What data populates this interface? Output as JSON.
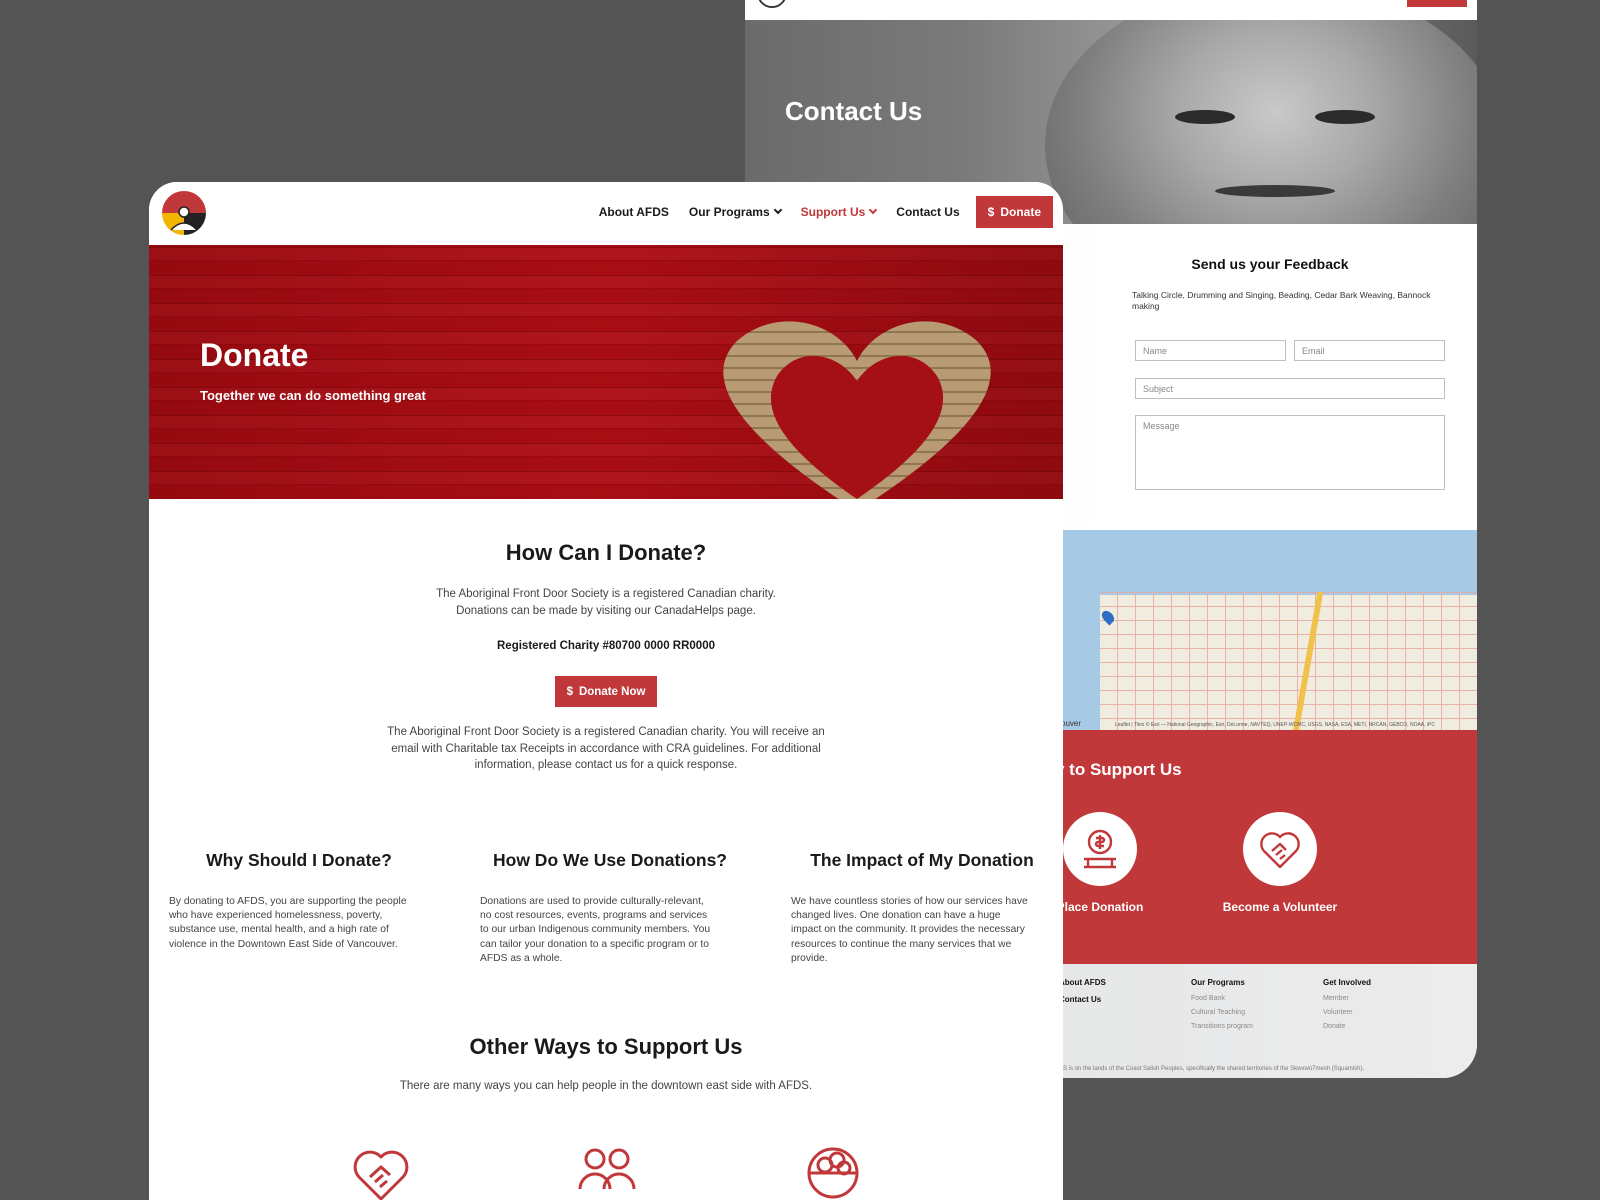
{
  "contact_page": {
    "hero_title": "Contact Us",
    "feedback": {
      "title": "Send us your Feedback",
      "intro": "Talking Circle, Drumming and Singing, Beading, Cedar Bark Weaving, Bannock making",
      "name_placeholder": "Name",
      "email_placeholder": "Email",
      "subject_placeholder": "Subject",
      "message_placeholder": "Message"
    },
    "map": {
      "city_label": "couver",
      "attribution": "Leaflet | Tiles © Esri — National Geographic, Esri, DeLorme, NAVTEQ, UNEP-WCMC, USGS, NASA, ESA, METI, NRCAN, GEBCO, NOAA, iPC"
    },
    "support": {
      "title": "y to Support Us",
      "items": [
        {
          "label": "Place Donation",
          "icon": "donation-icon"
        },
        {
          "label": "Become a Volunteer",
          "icon": "handshake-heart-icon"
        }
      ]
    },
    "footer": {
      "col1": [
        "About AFDS",
        "Contact Us"
      ],
      "programs_title": "Our Programs",
      "programs": [
        "Food Bank",
        "Cultural Teaching",
        "Transitions program"
      ],
      "involved_title": "Get Involved",
      "involved": [
        "Member",
        "Volunteer",
        "Donate"
      ],
      "acknowledgement": "FDS is on the lands of the Coast Salish Peoples, specifically the shared territories of the Skwxwú7mesh (Squamish),"
    }
  },
  "donate_page": {
    "nav": {
      "items": [
        "About AFDS",
        "Our Programs",
        "Support Us",
        "Contact Us"
      ],
      "donate_label": "Donate",
      "donate_symbol": "$"
    },
    "hero": {
      "title": "Donate",
      "subtitle": "Together we can do something great"
    },
    "how": {
      "title": "How Can I Donate?",
      "line1": "The Aboriginal Front Door Society is a registered Canadian charity.",
      "line2": "Donations can be made by visiting our CanadaHelps page.",
      "charity": "Registered Charity #80700 0000 RR0000",
      "button": "Donate Now",
      "button_symbol": "$",
      "note1": "The Aboriginal Front Door Society is a registered Canadian charity.  You will receive an",
      "note2": "email with Charitable tax Receipts in accordance with CRA guidelines. For additional",
      "note3": "information, please contact us for a quick response."
    },
    "columns": [
      {
        "title": "Why Should I Donate?",
        "lines": [
          "By donating to AFDS, you are supporting the people",
          "who have experienced homelessness, poverty,",
          "substance use, mental health, and a high rate of",
          "violence in the Downtown East Side of Vancouver."
        ]
      },
      {
        "title": "How Do We Use Donations?",
        "lines": [
          "Donations are used to provide culturally-relevant,",
          "no cost resources, events, programs and services",
          "to our urban Indigenous community members. You",
          "can tailor your donation to a specific program or to",
          "AFDS as a whole."
        ]
      },
      {
        "title": "The Impact of My Donation",
        "lines": [
          "We have countless stories of how our services have",
          "changed lives. One donation can have a huge",
          "impact on the community. It provides the necessary",
          "resources to continue the many services that we",
          "provide."
        ]
      }
    ],
    "other": {
      "title": "Other Ways to Support Us",
      "subtitle": "There are many ways you can help people in the downtown east side with AFDS.",
      "icons": [
        "handshake-heart-icon",
        "people-icon",
        "food-bowl-icon"
      ]
    }
  },
  "colors": {
    "accent": "#c0383a",
    "background": "#545454"
  }
}
